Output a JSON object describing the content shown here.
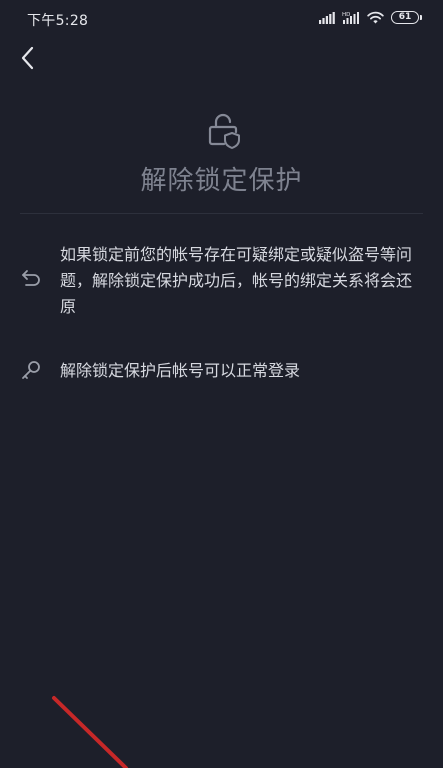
{
  "status_bar": {
    "time": "下午5:28",
    "network_label": "HD",
    "battery": "61"
  },
  "header": {
    "back_icon": "chevron-left-icon"
  },
  "main": {
    "lock_icon": "lock-shield-icon",
    "title": "解除锁定保护",
    "items": [
      {
        "icon": "undo-arrow-icon",
        "text": "如果锁定前您的帐号存在可疑绑定或疑似盗号等问题，解除锁定保护成功后，帐号的绑定关系将会还原"
      },
      {
        "icon": "key-icon",
        "text": "解除锁定保护后帐号可以正常登录"
      }
    ]
  },
  "colors": {
    "background": "#1d1f2a",
    "title": "#7e828f",
    "text": "#d7d9e0",
    "divider": "#2d303c",
    "annotation_arrow": "#c62828"
  }
}
